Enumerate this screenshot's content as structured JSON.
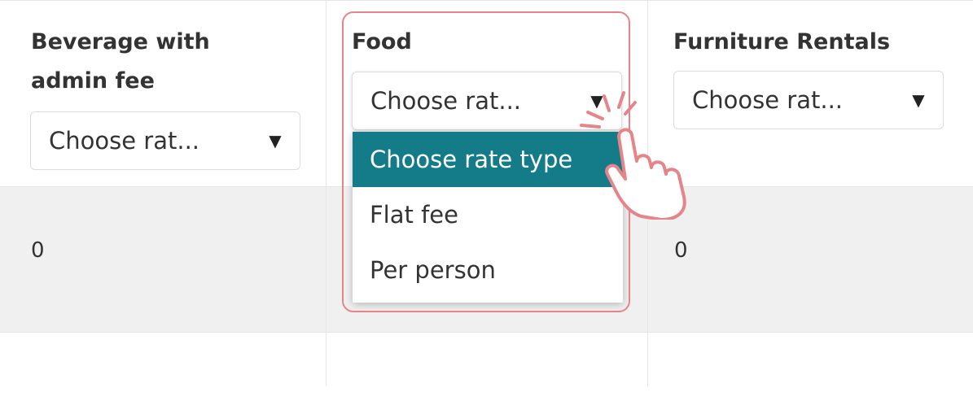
{
  "columns": [
    {
      "header": "Beverage with admin fee",
      "header_lines": [
        "Beverage with",
        "admin fee"
      ],
      "select_value": "Choose rat...",
      "cell_value": "0"
    },
    {
      "header": "Food",
      "select_value": "Choose rat...",
      "dropdown_open": true
    },
    {
      "header": "Furniture Rentals",
      "select_value": "Choose rat...",
      "cell_value": "0"
    }
  ],
  "dropdown": {
    "options": [
      "Choose rate type",
      "Flat fee",
      "Per person"
    ],
    "selected_index": 0
  },
  "colors": {
    "selected_option_bg": "#137c88",
    "highlight_border": "#e5858a",
    "row_band": "#f0f0f0"
  },
  "icons": {
    "caret": "caret-down-icon",
    "cursor": "pointing-hand-cursor-icon"
  }
}
